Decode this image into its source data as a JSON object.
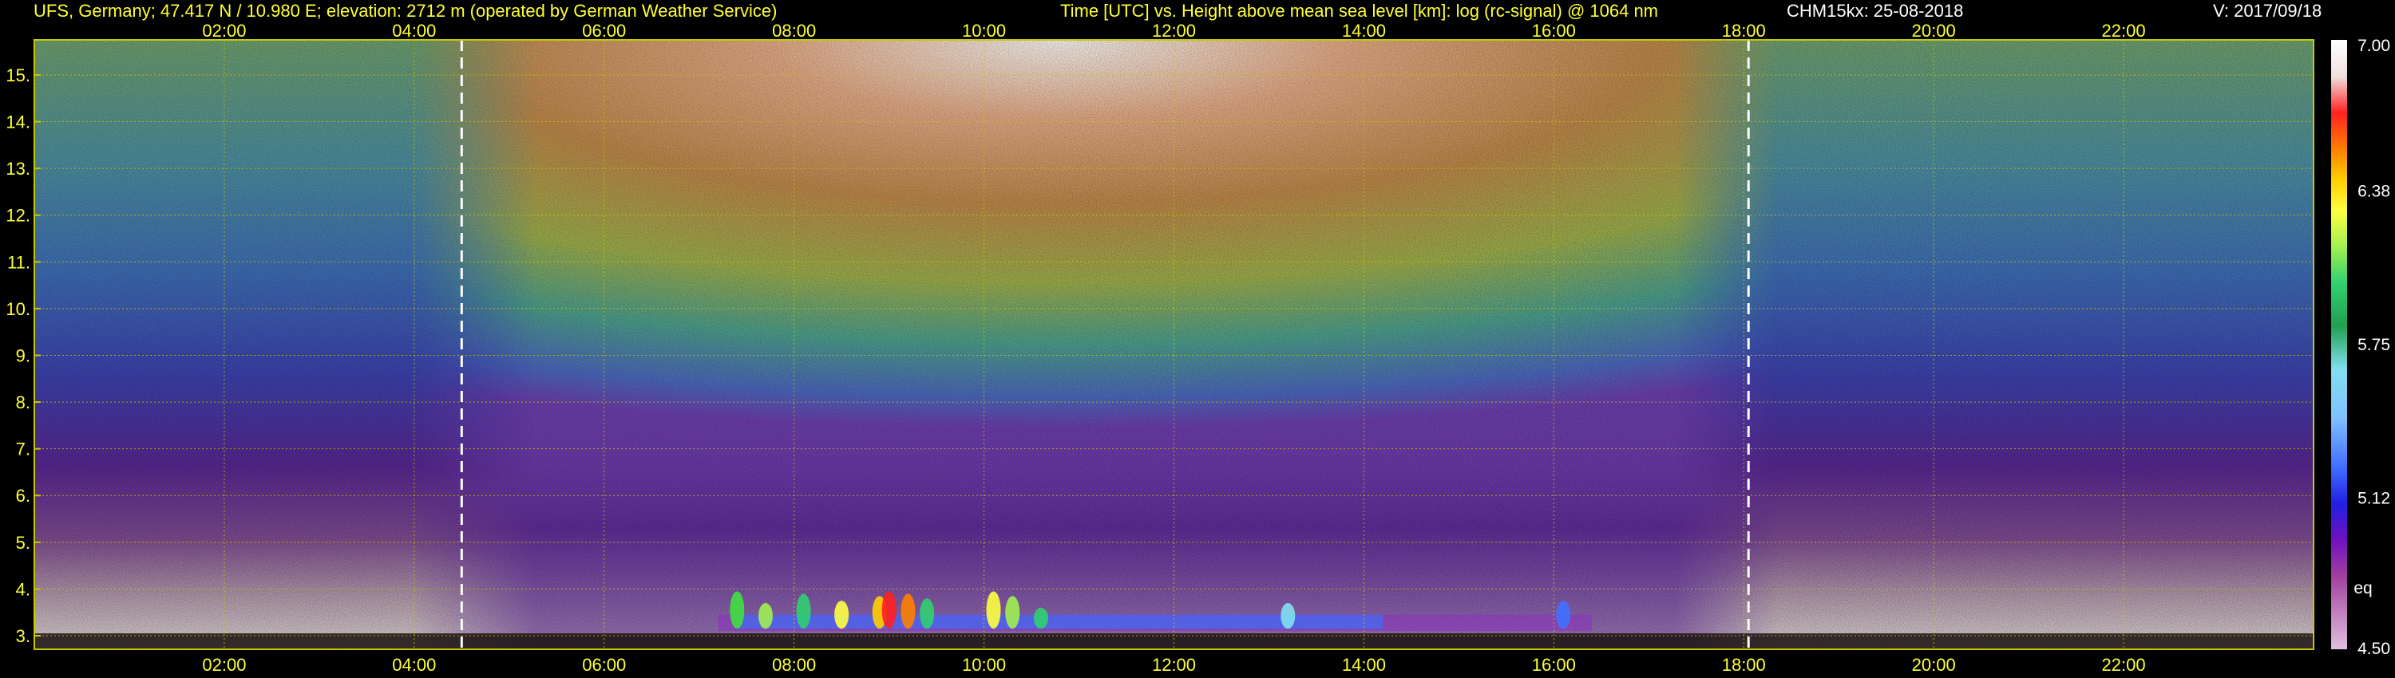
{
  "header": {
    "site": "UFS, Germany; 47.417 N / 10.980 E; elevation: 2712 m  (operated by German Weather Service)",
    "title": "Time [UTC] vs. Height above mean sea level [km]: log (rc-signal) @ 1064 nm",
    "instrument": "CHM15kx: 25-08-2018",
    "version": "V: 2017/09/18"
  },
  "chart_data": {
    "type": "heatmap",
    "title": "Time [UTC] vs. Height above mean sea level [km]: log (rc-signal) @ 1064 nm",
    "xlabel": "Time [UTC]",
    "ylabel": "Height above mean sea level [km]",
    "xlim": [
      0.0,
      24.0
    ],
    "ylim": [
      2.71,
      15.75
    ],
    "x_ticks": [
      "02:00",
      "04:00",
      "06:00",
      "08:00",
      "10:00",
      "12:00",
      "14:00",
      "16:00",
      "18:00",
      "20:00",
      "22:00"
    ],
    "x_tick_values": [
      2,
      4,
      6,
      8,
      10,
      12,
      14,
      16,
      18,
      20,
      22
    ],
    "y_ticks": [
      "3.",
      "4.",
      "5.",
      "6.",
      "7.",
      "8.",
      "9.",
      "10.",
      "11.",
      "12.",
      "13.",
      "14.",
      "15."
    ],
    "y_tick_values": [
      3,
      4,
      5,
      6,
      7,
      8,
      9,
      10,
      11,
      12,
      13,
      14,
      15
    ],
    "grid": true,
    "grid_color": "#c8c800",
    "day_night_markers_utc": [
      4.5,
      18.05
    ],
    "colorbar": {
      "min": 4.5,
      "max": 7.0,
      "labels": [
        "7.00",
        "6.38",
        "5.75",
        "5.12",
        "4.50"
      ],
      "label_values": [
        7.0,
        6.38,
        5.75,
        5.12,
        4.5
      ],
      "note": "eq",
      "colors": [
        "#ffffff",
        "#f0e0e0",
        "#ff2020",
        "#ff8000",
        "#ffd000",
        "#ffff40",
        "#a0f050",
        "#30d070",
        "#20a050",
        "#80e0f0",
        "#80c0ff",
        "#4070ff",
        "#2020e0",
        "#7010c0",
        "#a040a0",
        "#c080c0",
        "#e0c0e0"
      ]
    }
  }
}
